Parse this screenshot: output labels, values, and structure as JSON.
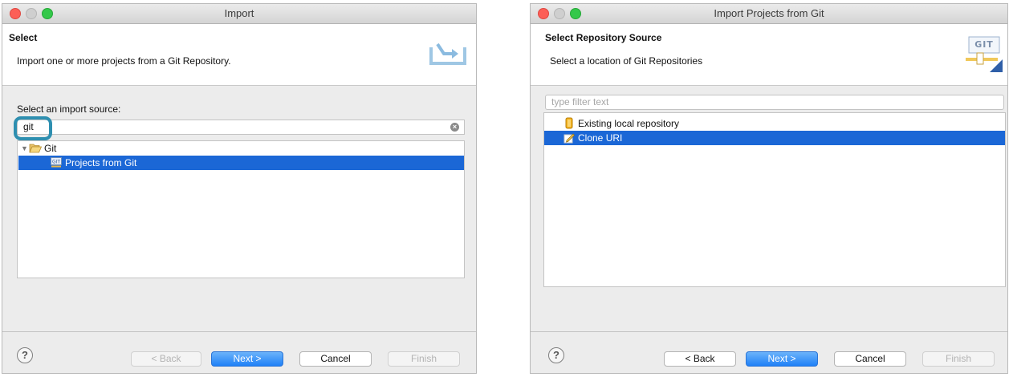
{
  "left_dialog": {
    "window_title": "Import",
    "header_title": "Select",
    "header_description": "Import one or more projects from a Git Repository.",
    "source_label": "Select an import source:",
    "filter_value": "git",
    "tree": [
      {
        "label": "Git",
        "expanded": true,
        "icon": "folder-open-icon"
      },
      {
        "label": "Projects from Git",
        "selected": true,
        "icon": "git-projects-icon"
      }
    ],
    "buttons": {
      "back": "< Back",
      "next": "Next >",
      "cancel": "Cancel",
      "finish": "Finish"
    },
    "help_glyph": "?"
  },
  "right_dialog": {
    "window_title": "Import Projects from Git",
    "header_title": "Select Repository Source",
    "header_description": "Select a location of Git Repositories",
    "header_icon_text": "GIT",
    "filter_placeholder": "type filter text",
    "list": [
      {
        "label": "Existing local repository",
        "selected": false,
        "icon": "repository-icon"
      },
      {
        "label": "Clone URI",
        "selected": true,
        "icon": "clone-icon"
      }
    ],
    "buttons": {
      "back": "< Back",
      "next": "Next >",
      "cancel": "Cancel",
      "finish": "Finish"
    },
    "help_glyph": "?"
  },
  "colors": {
    "selection": "#1b67d6",
    "highlight_ring": "#2e8fb0",
    "primary_button": "#1f80f7"
  }
}
